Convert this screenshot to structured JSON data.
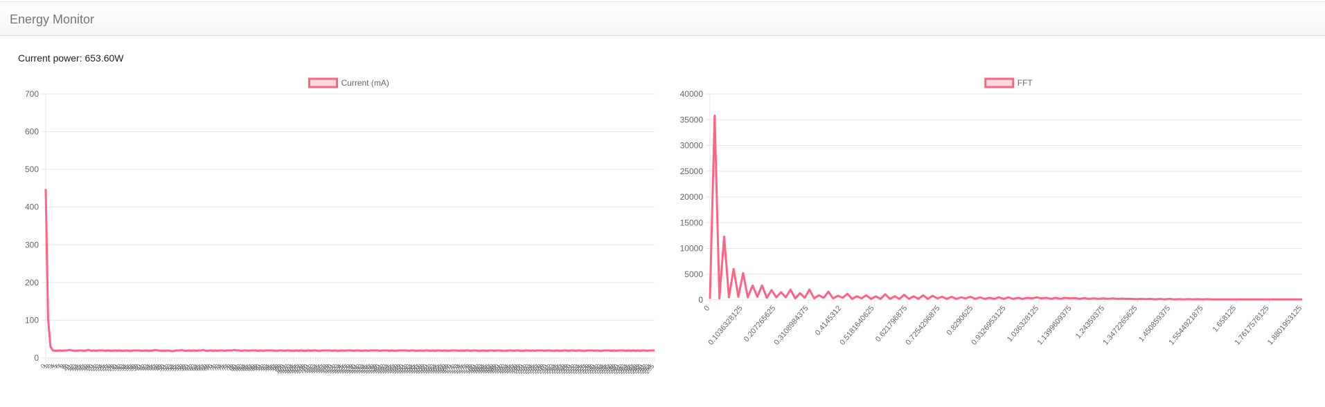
{
  "app": {
    "title": "Energy Monitor"
  },
  "status": {
    "label": "Current power:",
    "value": "653.60W"
  },
  "colors": {
    "series": "#ff6384",
    "series_fill": "rgba(255,99,132,0.25)",
    "grid": "#e6e6e6",
    "tick": "#666666"
  },
  "chart_data": [
    {
      "type": "line",
      "series": [
        {
          "name": "Current (mA)"
        }
      ],
      "x_ticks": [
        "0",
        "1",
        "2",
        "3",
        "4",
        "5",
        "6",
        "7",
        "8",
        "9",
        "10",
        "11",
        "12",
        "13",
        "14",
        "15",
        "16",
        "17",
        "18",
        "19",
        "20",
        "21",
        "22",
        "23",
        "24",
        "25",
        "26",
        "27",
        "28",
        "29",
        "30",
        "31",
        "32",
        "33",
        "34",
        "35",
        "36",
        "37",
        "38",
        "39",
        "40",
        "41",
        "42",
        "43",
        "44",
        "45",
        "46",
        "47",
        "48",
        "49",
        "50",
        "51",
        "52",
        "53",
        "54",
        "55",
        "56",
        "57",
        "58",
        "59",
        "60",
        "61",
        "62",
        "63",
        "64",
        "65",
        "66",
        "67",
        "68",
        "69",
        "70",
        "71",
        "72",
        "73",
        "74",
        "75",
        "76",
        "77",
        "78",
        "79",
        "80",
        "81",
        "82",
        "83",
        "84",
        "85",
        "86",
        "87",
        "88",
        "89",
        "90",
        "91",
        "92",
        "93",
        "94",
        "95",
        "96",
        "97",
        "98",
        "99",
        "100",
        "101",
        "102",
        "103",
        "104",
        "105",
        "106",
        "107",
        "108",
        "109",
        "110",
        "111",
        "112",
        "113",
        "114",
        "115",
        "116",
        "117",
        "118",
        "119",
        "120",
        "121",
        "122",
        "123",
        "124",
        "125",
        "126",
        "127",
        "128",
        "129",
        "130",
        "131",
        "132",
        "133",
        "134",
        "135",
        "136",
        "137",
        "138",
        "139",
        "140",
        "141",
        "142",
        "143",
        "144",
        "145",
        "146",
        "147",
        "148",
        "149",
        "150",
        "151",
        "152",
        "153",
        "154",
        "155",
        "156",
        "157",
        "158",
        "159",
        "160",
        "161",
        "162",
        "163",
        "164",
        "165",
        "166",
        "167",
        "168",
        "169",
        "170",
        "171",
        "172",
        "173",
        "174",
        "175",
        "176",
        "177",
        "178",
        "179",
        "180",
        "181",
        "182",
        "183",
        "184",
        "185",
        "186",
        "187",
        "188",
        "189",
        "190",
        "191",
        "192",
        "193",
        "194",
        "195",
        "196",
        "197",
        "198",
        "199",
        "200",
        "201",
        "202",
        "203",
        "204",
        "205",
        "206",
        "207",
        "208",
        "209",
        "210",
        "211",
        "212",
        "213",
        "214",
        "215",
        "216",
        "217",
        "218",
        "219",
        "220",
        "221",
        "222",
        "223",
        "224",
        "225",
        "226",
        "227",
        "228",
        "229",
        "230",
        "231",
        "232",
        "233",
        "234",
        "235",
        "236",
        "237",
        "238",
        "239",
        "240",
        "241",
        "242",
        "243",
        "244",
        "245",
        "246",
        "247",
        "248",
        "249",
        "250",
        "251",
        "252",
        "253",
        "254",
        "255"
      ],
      "values": [
        448,
        105,
        30,
        20,
        19,
        19,
        20,
        19,
        20,
        20,
        21,
        20,
        19,
        19,
        20,
        20,
        19,
        20,
        21,
        19,
        20,
        19,
        20,
        20,
        20,
        19,
        20,
        19,
        19,
        20,
        19,
        20,
        19,
        19,
        20,
        19,
        19,
        20,
        20,
        20,
        19,
        19,
        20,
        19,
        19,
        20,
        21,
        20,
        19,
        19,
        19,
        20,
        19,
        18,
        19,
        20,
        20,
        21,
        19,
        19,
        20,
        19,
        20,
        19,
        20,
        20,
        21,
        19,
        19,
        20,
        19,
        20,
        19,
        20,
        20,
        19,
        20,
        20,
        20,
        21,
        20,
        20,
        19,
        20,
        20,
        19,
        20,
        20,
        20,
        19,
        20,
        19,
        20,
        20,
        20,
        20,
        19,
        19,
        20,
        20,
        19,
        20,
        20,
        19,
        19,
        20,
        19,
        20,
        19,
        19,
        20,
        19,
        20,
        20,
        19,
        19,
        20,
        20,
        20,
        20,
        19,
        20,
        19,
        19,
        20,
        19,
        20,
        20,
        20,
        19,
        20,
        20,
        19,
        19,
        20,
        19,
        20,
        20,
        20,
        20,
        19,
        20,
        20,
        20,
        19,
        20,
        19,
        19,
        20,
        20,
        20,
        20,
        19,
        20,
        20,
        19,
        19,
        20,
        19,
        20,
        20,
        19,
        20,
        19,
        20,
        20,
        19,
        20,
        19,
        19,
        20,
        20,
        20,
        19,
        20,
        19,
        20,
        20,
        19,
        20,
        20,
        19,
        19,
        20,
        19,
        19,
        20,
        20,
        19,
        20,
        20,
        19,
        19,
        19,
        20,
        20,
        19,
        20,
        20,
        19,
        19,
        20,
        20,
        19,
        20,
        19,
        20,
        20,
        20,
        19,
        20,
        20,
        19,
        19,
        20,
        19,
        19,
        20,
        20,
        19,
        20,
        20,
        19,
        20,
        20,
        19,
        19,
        20,
        20,
        20,
        19,
        20,
        19,
        19,
        20,
        20,
        20,
        19,
        20,
        19,
        20,
        20,
        20,
        19,
        20,
        19,
        20,
        19,
        20,
        19,
        20,
        20,
        19,
        20,
        20,
        20
      ],
      "ylim": [
        0,
        700
      ],
      "y_ticks": [
        0,
        100,
        200,
        300,
        400,
        500,
        600,
        700
      ],
      "legend_position": "top",
      "grid": true
    },
    {
      "type": "line",
      "series": [
        {
          "name": "FFT"
        }
      ],
      "x_ticks": [
        "0",
        "0.1036328125",
        "0.207265625",
        "0.3108984375",
        "0.4145312",
        "0.5181640625",
        "0.621796875",
        "0.7254296875",
        "0.8290625",
        "0.9326953125",
        "1.036328125",
        "1.1399609375",
        "1.24359375",
        "1.3472265625",
        "1.450859375",
        "1.5544921875",
        "1.658125",
        "1.7617578125",
        "1.8801953125"
      ],
      "values": [
        200,
        35800,
        300,
        12300,
        500,
        6000,
        600,
        5200,
        500,
        2800,
        600,
        2800,
        400,
        1900,
        500,
        1500,
        500,
        2000,
        300,
        1300,
        400,
        2000,
        300,
        900,
        400,
        1600,
        300,
        800,
        400,
        1200,
        200,
        700,
        300,
        900,
        200,
        700,
        200,
        1100,
        200,
        700,
        200,
        1000,
        200,
        700,
        200,
        900,
        200,
        800,
        300,
        600,
        200,
        600,
        200,
        500,
        300,
        600,
        200,
        500,
        200,
        400,
        200,
        500,
        200,
        500,
        200,
        400,
        200,
        400,
        300,
        500,
        300,
        400,
        200,
        400,
        200,
        400,
        300,
        350,
        200,
        350,
        200,
        300,
        200,
        300,
        200,
        300,
        200,
        250,
        200,
        200,
        150,
        200,
        150,
        200,
        100,
        200,
        100,
        200,
        100,
        150,
        100,
        150,
        100,
        150,
        100,
        150,
        100,
        100,
        100,
        100,
        100,
        100,
        100,
        100,
        100,
        100,
        100,
        100,
        100,
        100,
        100,
        100,
        100,
        100,
        100,
        100
      ],
      "ylim": [
        0,
        40000
      ],
      "y_ticks": [
        0,
        5000,
        10000,
        15000,
        20000,
        25000,
        30000,
        35000,
        40000
      ],
      "legend_position": "top",
      "grid": true
    }
  ]
}
